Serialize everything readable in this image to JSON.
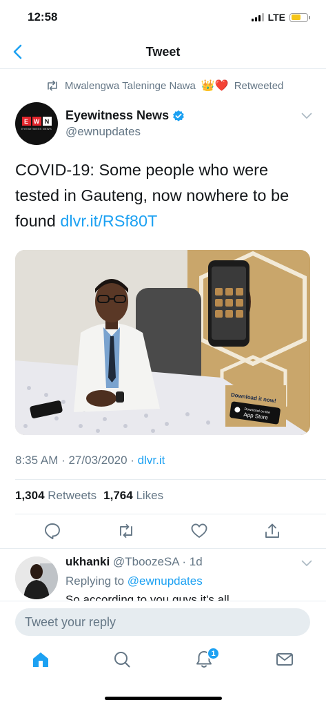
{
  "status": {
    "time": "12:58",
    "network": "LTE"
  },
  "nav": {
    "title": "Tweet"
  },
  "retweet": {
    "user": "Mwalengwa Taleninge Nawa",
    "emoji": "👑❤️",
    "label": "Retweeted"
  },
  "author": {
    "name": "Eyewitness News",
    "handle": "@ewnupdates",
    "logo_letters": [
      "E",
      "W",
      "N"
    ],
    "logo_tagline": "EYEWITNESS NEWS"
  },
  "tweet": {
    "text": "COVID-19: Some people who were tested in Gauteng, now nowhere to be found",
    "link": "dlvr.it/RSf80T",
    "timestamp": "8:35 AM · 27/03/2020 · ",
    "source": "dlvr.it"
  },
  "stats": {
    "retweets_count": "1,304",
    "retweets_label": "Retweets",
    "likes_count": "1,764",
    "likes_label": "Likes"
  },
  "media": {
    "banner_text": "Download it now!",
    "store_small": "Download on the",
    "store_big": "App Store"
  },
  "reply": {
    "name": "ukhanki",
    "handle_time": "@TboozeSA · 1d",
    "replying_prefix": "Replying to",
    "replying_to": "@ewnupdates",
    "snippet": "So according to you guys it's all"
  },
  "compose": {
    "placeholder": "Tweet your reply"
  },
  "tabs": {
    "notification_count": "1"
  },
  "colors": {
    "accent": "#1da1f2",
    "secondary_text": "#657786",
    "battery": "#f5c518"
  }
}
